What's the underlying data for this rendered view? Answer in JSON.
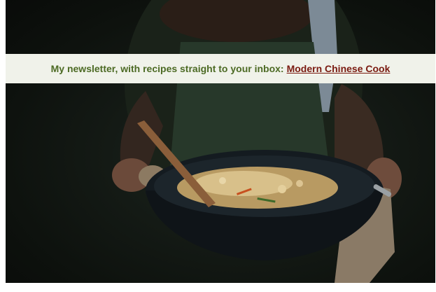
{
  "banner": {
    "text": "My newsletter, with recipes straight to your inbox:",
    "link_label": "Modern Chinese Cook"
  },
  "colors": {
    "banner_background": "#f0f2ea",
    "banner_text": "#4c6a24",
    "link_text": "#7a1a10",
    "photo_background": "#0d110d"
  },
  "hero_image": {
    "icon": "photo-person-holding-wok-of-noodles"
  }
}
